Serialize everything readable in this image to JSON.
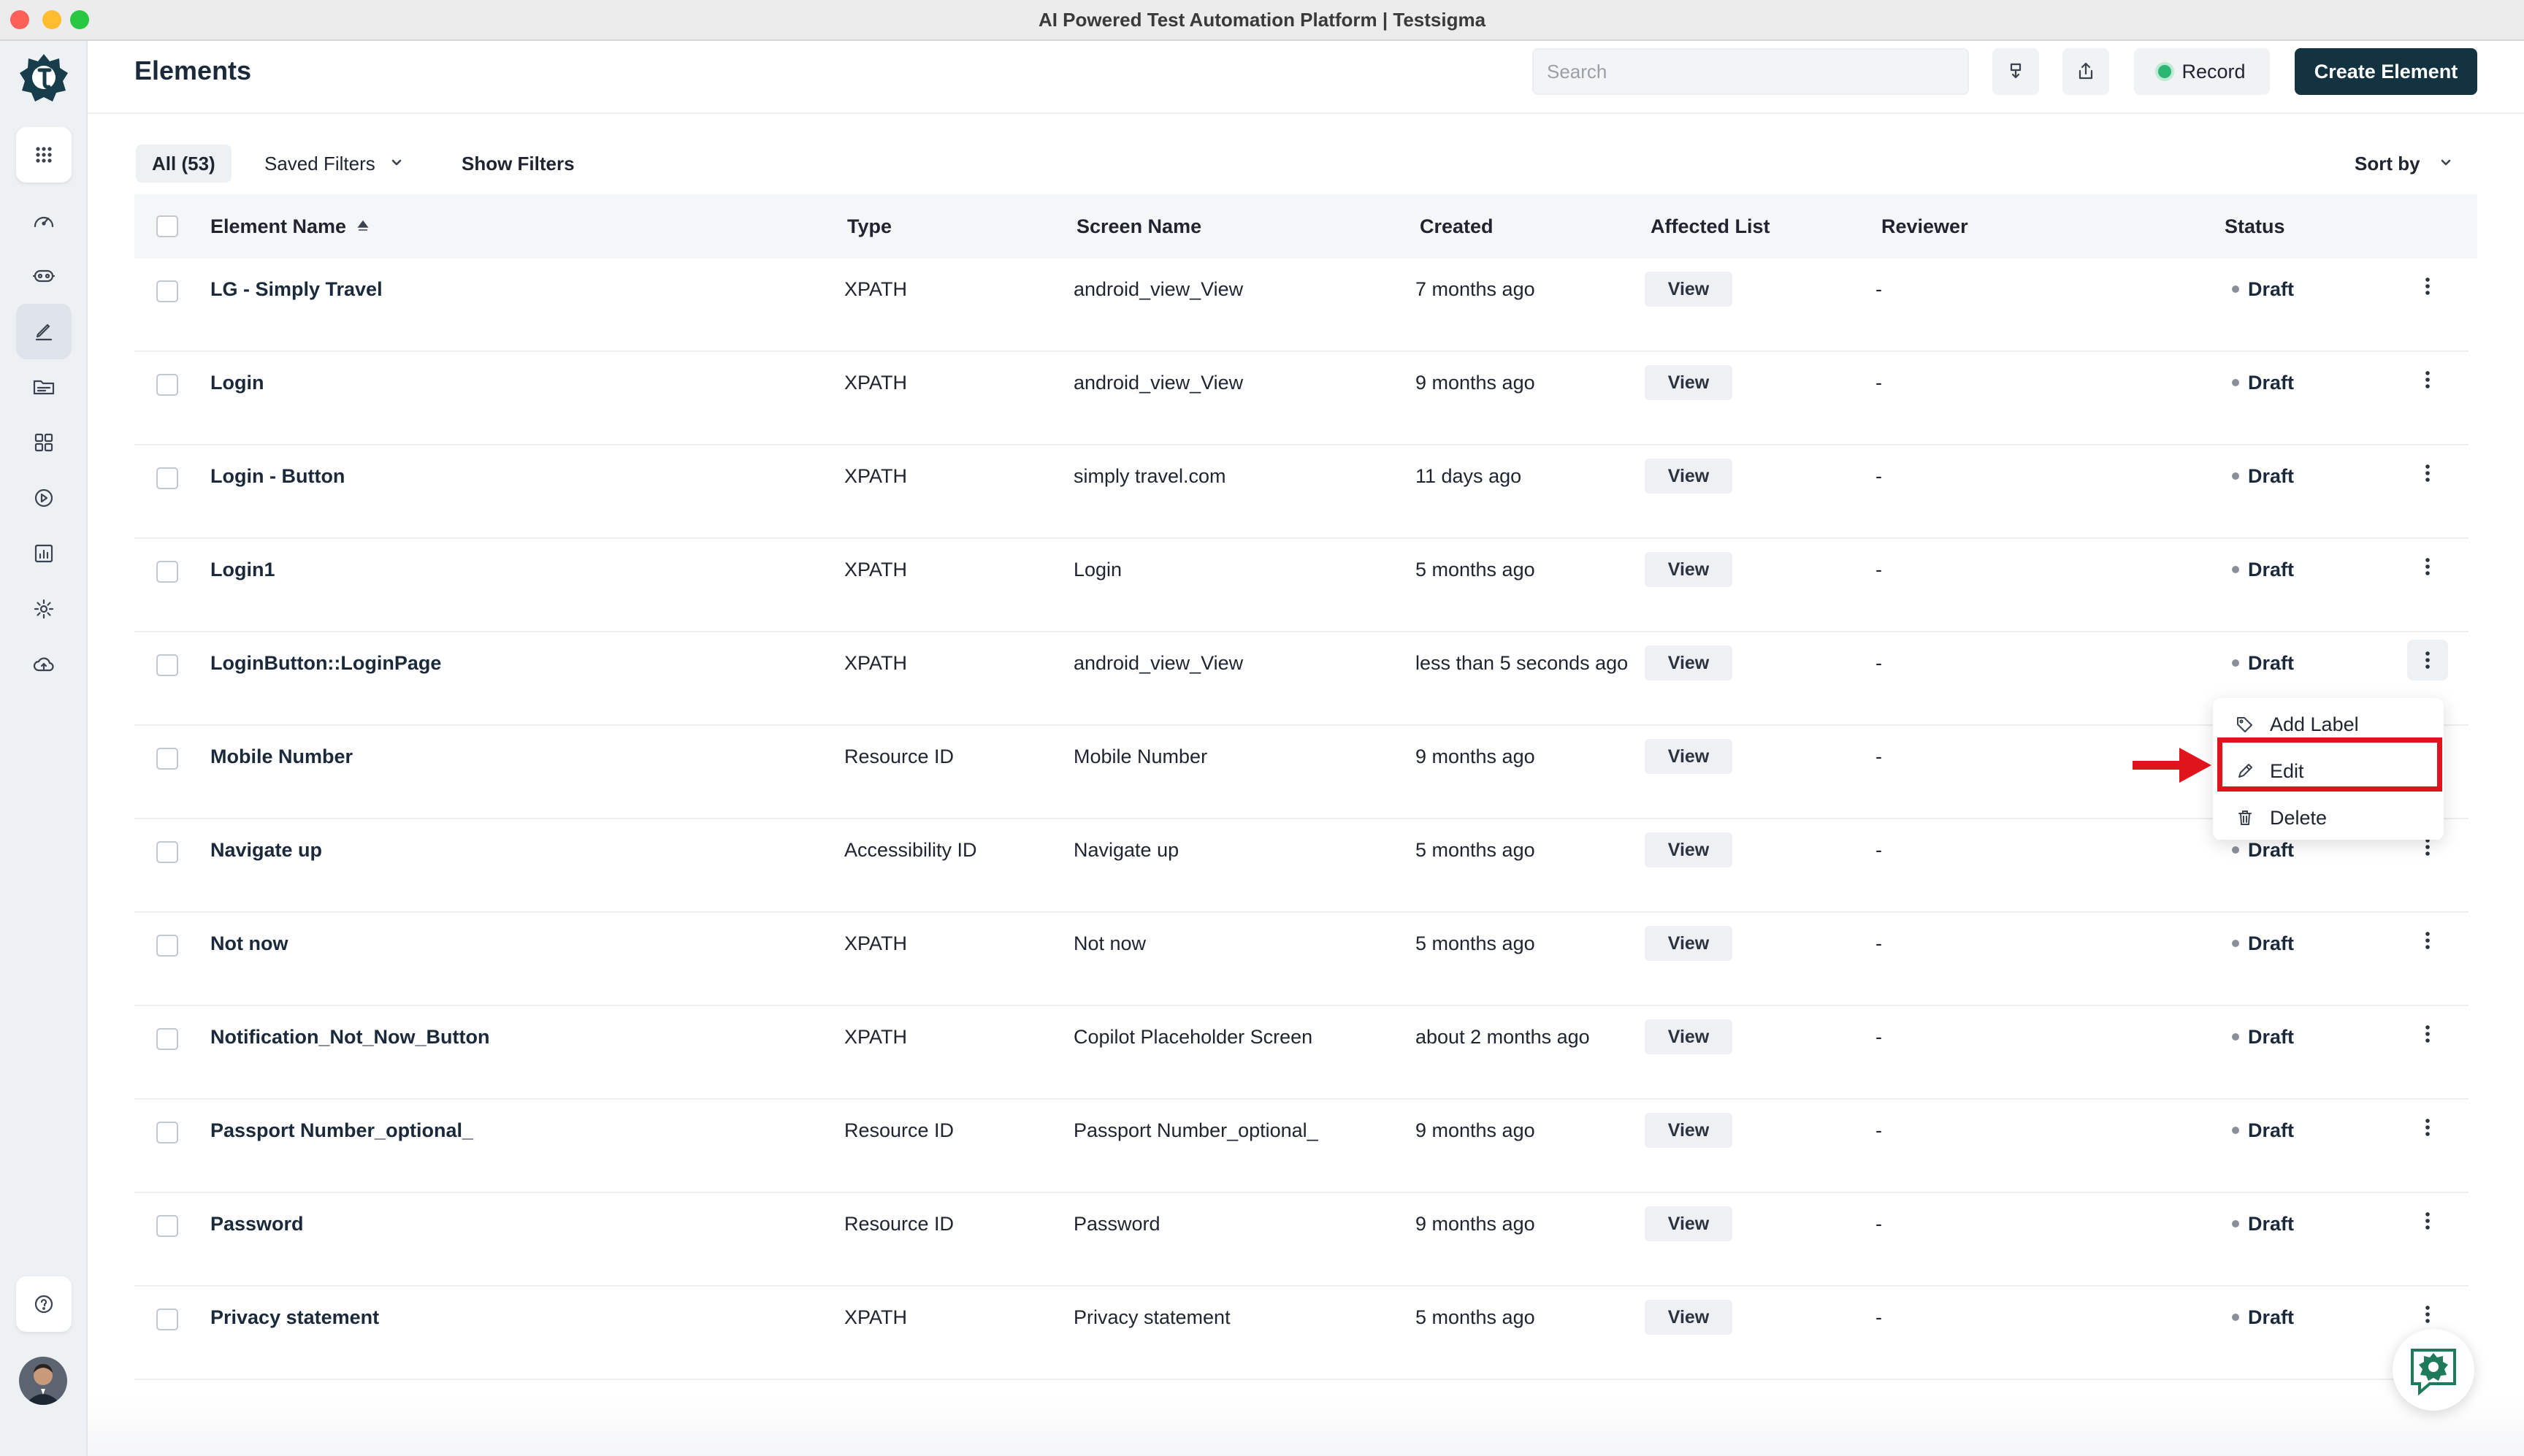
{
  "window": {
    "title": "AI Powered Test Automation Platform | Testsigma"
  },
  "header": {
    "page_title": "Elements",
    "search_placeholder": "Search",
    "record_label": "Record",
    "create_label": "Create Element"
  },
  "filters": {
    "all_label": "All (53)",
    "saved_filters_label": "Saved Filters",
    "show_filters_label": "Show Filters",
    "sort_by_label": "Sort by"
  },
  "table": {
    "columns": [
      "Element Name",
      "Type",
      "Screen Name",
      "Created",
      "Affected List",
      "Reviewer",
      "Status"
    ],
    "view_label": "View",
    "rows": [
      {
        "name": "LG - Simply Travel",
        "type": "XPATH",
        "screen": "android_view_View",
        "created": "7 months ago",
        "reviewer": "-",
        "status": "Draft"
      },
      {
        "name": "Login",
        "type": "XPATH",
        "screen": "android_view_View",
        "created": "9 months ago",
        "reviewer": "-",
        "status": "Draft"
      },
      {
        "name": "Login - Button",
        "type": "XPATH",
        "screen": "simply travel.com",
        "created": "11 days ago",
        "reviewer": "-",
        "status": "Draft"
      },
      {
        "name": "Login1",
        "type": "XPATH",
        "screen": "Login",
        "created": "5 months ago",
        "reviewer": "-",
        "status": "Draft"
      },
      {
        "name": "LoginButton::LoginPage",
        "type": "XPATH",
        "screen": "android_view_View",
        "created": "less than 5 seconds ago",
        "reviewer": "-",
        "status": "Draft"
      },
      {
        "name": "Mobile Number",
        "type": "Resource ID",
        "screen": "Mobile Number",
        "created": "9 months ago",
        "reviewer": "-",
        "status": ""
      },
      {
        "name": "Navigate up",
        "type": "Accessibility ID",
        "screen": "Navigate up",
        "created": "5 months ago",
        "reviewer": "-",
        "status": "Draft"
      },
      {
        "name": "Not now",
        "type": "XPATH",
        "screen": "Not now",
        "created": "5 months ago",
        "reviewer": "-",
        "status": "Draft"
      },
      {
        "name": "Notification_Not_Now_Button",
        "type": "XPATH",
        "screen": "Copilot Placeholder Screen",
        "created": "about 2 months ago",
        "reviewer": "-",
        "status": "Draft"
      },
      {
        "name": "Passport Number_optional_",
        "type": "Resource ID",
        "screen": "Passport Number_optional_",
        "created": "9 months ago",
        "reviewer": "-",
        "status": "Draft"
      },
      {
        "name": "Password",
        "type": "Resource ID",
        "screen": "Password",
        "created": "9 months ago",
        "reviewer": "-",
        "status": "Draft"
      },
      {
        "name": "Privacy statement",
        "type": "XPATH",
        "screen": "Privacy statement",
        "created": "5 months ago",
        "reviewer": "-",
        "status": "Draft"
      }
    ]
  },
  "context_menu": {
    "items": [
      "Add Label",
      "Edit",
      "Delete"
    ]
  },
  "colors": {
    "primary": "#12333f",
    "record_dot": "#2bb673",
    "highlight": "#e0141c",
    "brand_green": "#1e7a5a"
  }
}
